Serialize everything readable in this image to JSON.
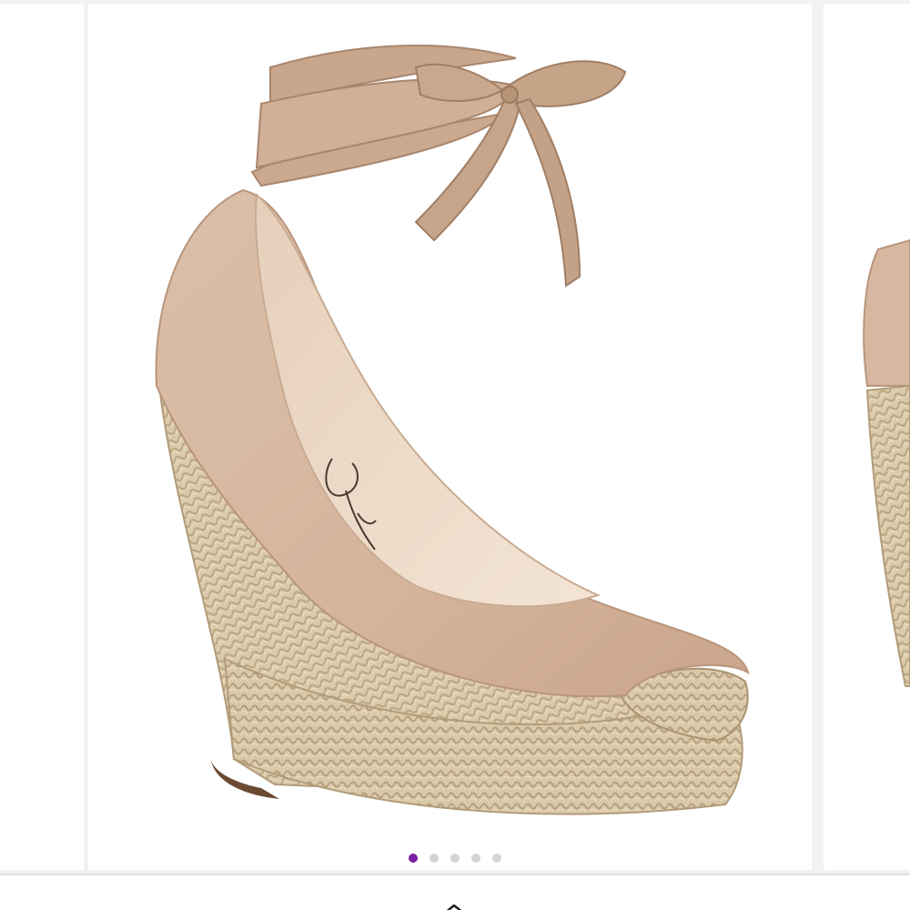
{
  "product_gallery": {
    "current_slide": 1,
    "slide_count": 5,
    "image_subject": "espadrille-wedge-pump-icon",
    "insole_logo_text": "Simpson",
    "colors": {
      "dot_active": "#7b1fa2",
      "dot_inactive": "#d4d4d4",
      "suede": "#d7b79f",
      "jute": "#d9c8a8",
      "ribbon": "#c9a98f"
    }
  },
  "bottom_bar": {
    "icon": "chevron-up-icon"
  }
}
